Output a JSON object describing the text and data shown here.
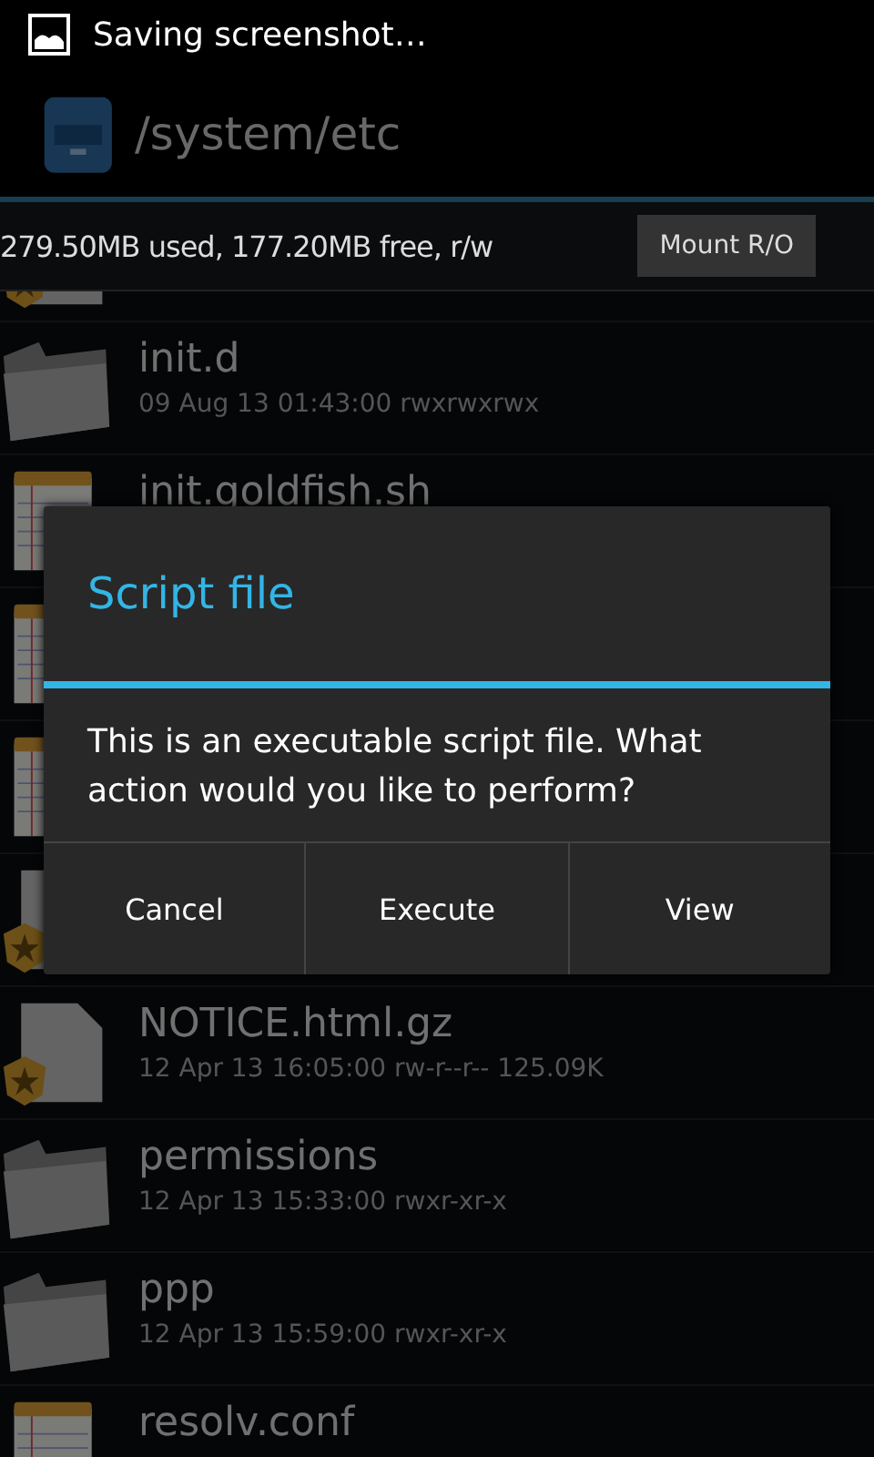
{
  "status_bar": {
    "notification": "Saving screenshot…"
  },
  "action_bar": {
    "path": "/system/etc"
  },
  "storage_bar": {
    "usage": "279.50MB used, 177.20MB free, r/w",
    "button": "Mount R/O"
  },
  "files": [
    {
      "kind": "secure"
    },
    {
      "kind": "folder",
      "name": "init.d",
      "meta": "09 Aug 13 01:43:00  rwxrwxrwx"
    },
    {
      "kind": "script",
      "name": "init.goldfish.sh"
    },
    {
      "kind": "script"
    },
    {
      "kind": "script"
    },
    {
      "kind": "secure"
    },
    {
      "kind": "secure",
      "name": "NOTICE.html.gz",
      "meta": "12 Apr 13 16:05:00  rw-r--r--  125.09K"
    },
    {
      "kind": "folder",
      "name": "permissions",
      "meta": "12 Apr 13 15:33:00  rwxr-xr-x"
    },
    {
      "kind": "folder",
      "name": "ppp",
      "meta": "12 Apr 13 15:59:00  rwxr-xr-x"
    },
    {
      "kind": "script",
      "name": "resolv.conf"
    }
  ],
  "dialog": {
    "title": "Script file",
    "message": "This is an executable script file. What action would you like to perform?",
    "buttons": [
      "Cancel",
      "Execute",
      "View"
    ]
  }
}
